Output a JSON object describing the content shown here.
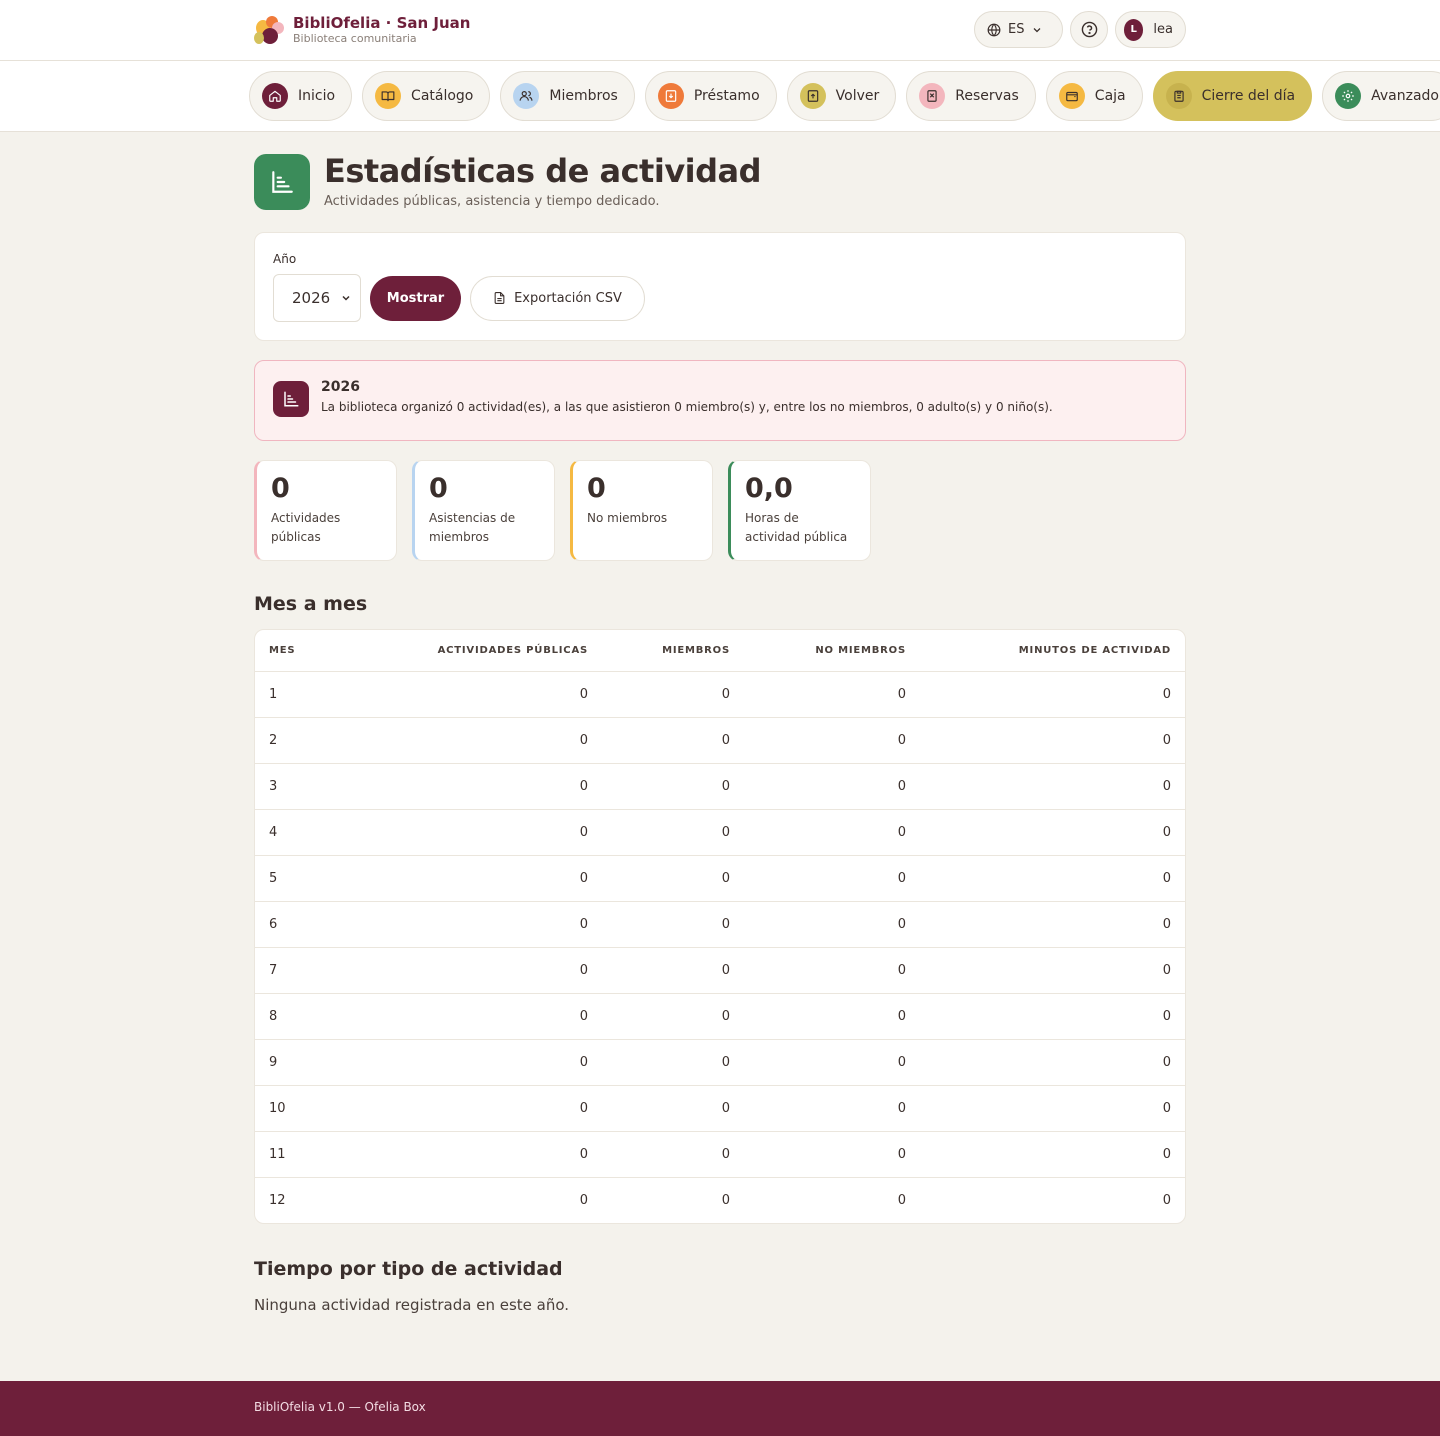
{
  "brand": {
    "title": "BibliOfelia · San Juan",
    "subtitle": "Biblioteca comunitaria"
  },
  "top": {
    "language": "ES",
    "user_initial": "L",
    "user_name": "lea"
  },
  "nav": {
    "items": [
      {
        "label": "Inicio",
        "icon": "home-icon",
        "color": "#6e1f3a"
      },
      {
        "label": "Catálogo",
        "icon": "book-icon",
        "color": "#f5b942"
      },
      {
        "label": "Miembros",
        "icon": "users-icon",
        "color": "#b8d4f0"
      },
      {
        "label": "Préstamo",
        "icon": "loan-icon",
        "color": "#ef7a3a"
      },
      {
        "label": "Volver",
        "icon": "return-icon",
        "color": "#d4c15c"
      },
      {
        "label": "Reservas",
        "icon": "bookmark-icon",
        "color": "#f3b6bd"
      },
      {
        "label": "Caja",
        "icon": "wallet-icon",
        "color": "#f5b942"
      },
      {
        "label": "Cierre del día",
        "icon": "clipboard-icon",
        "color": "#c7b24e"
      },
      {
        "label": "Avanzado",
        "icon": "gear-icon",
        "color": "#3b8c5a"
      }
    ],
    "active_index": 7
  },
  "page": {
    "title": "Estadísticas de actividad",
    "subtitle": "Actividades públicas, asistencia y tiempo dedicado."
  },
  "filter": {
    "label": "Año",
    "year": "2026",
    "show_label": "Mostrar",
    "csv_label": "Exportación CSV"
  },
  "summary": {
    "year": "2026",
    "text": "La biblioteca organizó 0 actividad(es), a las que asistieron 0 miembro(s) y, entre los no miembros, 0 adulto(s) y 0 niño(s)."
  },
  "stats": [
    {
      "value": "0",
      "label": "Actividades públicas",
      "color": "#f3b6bd"
    },
    {
      "value": "0",
      "label": "Asistencias de miembros",
      "color": "#b8d4f0"
    },
    {
      "value": "0",
      "label": "No miembros",
      "color": "#f5b942"
    },
    {
      "value": "0,0",
      "label": "Horas de actividad pública",
      "color": "#3b8c5a"
    }
  ],
  "monthly": {
    "title": "Mes a mes",
    "columns": [
      "Mes",
      "Actividades públicas",
      "Miembros",
      "No miembros",
      "Minutos de actividad"
    ],
    "rows": [
      [
        "1",
        "0",
        "0",
        "0",
        "0"
      ],
      [
        "2",
        "0",
        "0",
        "0",
        "0"
      ],
      [
        "3",
        "0",
        "0",
        "0",
        "0"
      ],
      [
        "4",
        "0",
        "0",
        "0",
        "0"
      ],
      [
        "5",
        "0",
        "0",
        "0",
        "0"
      ],
      [
        "6",
        "0",
        "0",
        "0",
        "0"
      ],
      [
        "7",
        "0",
        "0",
        "0",
        "0"
      ],
      [
        "8",
        "0",
        "0",
        "0",
        "0"
      ],
      [
        "9",
        "0",
        "0",
        "0",
        "0"
      ],
      [
        "10",
        "0",
        "0",
        "0",
        "0"
      ],
      [
        "11",
        "0",
        "0",
        "0",
        "0"
      ],
      [
        "12",
        "0",
        "0",
        "0",
        "0"
      ]
    ]
  },
  "by_type": {
    "title": "Tiempo por tipo de actividad",
    "empty": "Ninguna actividad registrada en este año."
  },
  "footer": {
    "text": "BibliOfelia v1.0 — Ofelia Box"
  },
  "colors": {
    "brand": "#6e1f3a",
    "accent_green": "#3b8c5a",
    "active_nav": "#d4c15c"
  }
}
